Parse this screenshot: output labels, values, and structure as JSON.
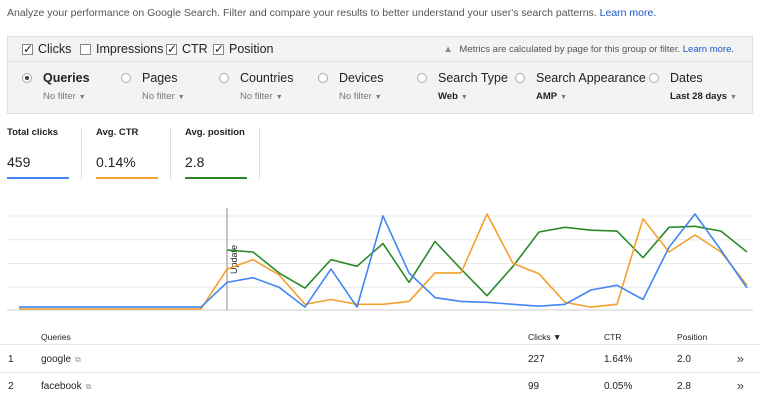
{
  "intro": {
    "text": "Analyze your performance on Google Search. Filter and compare your results to better understand your user's search patterns.",
    "link": "Learn more."
  },
  "metrics": {
    "items": [
      {
        "label": "Clicks",
        "checked": true
      },
      {
        "label": "Impressions",
        "checked": false
      },
      {
        "label": "CTR",
        "checked": true
      },
      {
        "label": "Position",
        "checked": true
      }
    ],
    "note": "Metrics are calculated by page for this group or filter.",
    "note_link": "Learn more."
  },
  "filters": [
    {
      "label": "Queries",
      "value": "No filter",
      "selected": true
    },
    {
      "label": "Pages",
      "value": "No filter",
      "selected": false
    },
    {
      "label": "Countries",
      "value": "No filter",
      "selected": false
    },
    {
      "label": "Devices",
      "value": "No filter",
      "selected": false
    },
    {
      "label": "Search Type",
      "value": "Web",
      "selected": false
    },
    {
      "label": "Search Appearance",
      "value": "AMP",
      "selected": false
    },
    {
      "label": "Dates",
      "value": "Last 28 days",
      "selected": false
    }
  ],
  "summary": [
    {
      "title": "Total clicks",
      "value": "459",
      "color": "#4285f4"
    },
    {
      "title": "Avg. CTR",
      "value": "0.14%",
      "color": "#f4a02d"
    },
    {
      "title": "Avg. position",
      "value": "2.8",
      "color": "#2a8a2a"
    }
  ],
  "chart_data": {
    "type": "line",
    "annotation": "Update",
    "annotation_index": 8,
    "ylim": [
      0,
      1
    ],
    "series": [
      {
        "key": "clicks",
        "color": "#4285f4",
        "values": [
          0.02,
          0.02,
          0.02,
          0.02,
          0.02,
          0.02,
          0.02,
          0.02,
          0.28,
          0.33,
          0.23,
          0.02,
          0.42,
          0.02,
          0.98,
          0.38,
          0.12,
          0.08,
          0.07,
          0.05,
          0.03,
          0.05,
          0.2,
          0.25,
          0.1,
          0.65,
          1.0,
          0.62,
          0.22
        ]
      },
      {
        "key": "ctr",
        "color": "#f4a02d",
        "values": [
          0,
          0,
          0,
          0,
          0,
          0,
          0,
          0,
          0.42,
          0.52,
          0.36,
          0.05,
          0.1,
          0.05,
          0.05,
          0.08,
          0.38,
          0.38,
          1.0,
          0.48,
          0.37,
          0.07,
          0.02,
          0.05,
          0.95,
          0.6,
          0.78,
          0.6,
          0.25
        ]
      },
      {
        "key": "position",
        "color": "#2a8a2a",
        "values": [
          null,
          null,
          null,
          null,
          null,
          null,
          null,
          null,
          0.62,
          0.6,
          0.38,
          0.22,
          0.52,
          0.45,
          0.69,
          0.28,
          0.71,
          0.42,
          0.14,
          0.45,
          0.81,
          0.86,
          0.83,
          0.82,
          0.54,
          0.86,
          0.87,
          0.82,
          0.6
        ]
      }
    ]
  },
  "table": {
    "headers": {
      "queries": "Queries",
      "clicks": "Clicks ▼",
      "ctr": "CTR",
      "position": "Position"
    },
    "rows": [
      {
        "rank": "1",
        "query": "google",
        "clicks": "227",
        "ctr": "1.64%",
        "position": "2.0"
      },
      {
        "rank": "2",
        "query": "facebook",
        "clicks": "99",
        "ctr": "0.05%",
        "position": "2.8"
      }
    ],
    "more_icon": "double-chevron-right-icon"
  }
}
